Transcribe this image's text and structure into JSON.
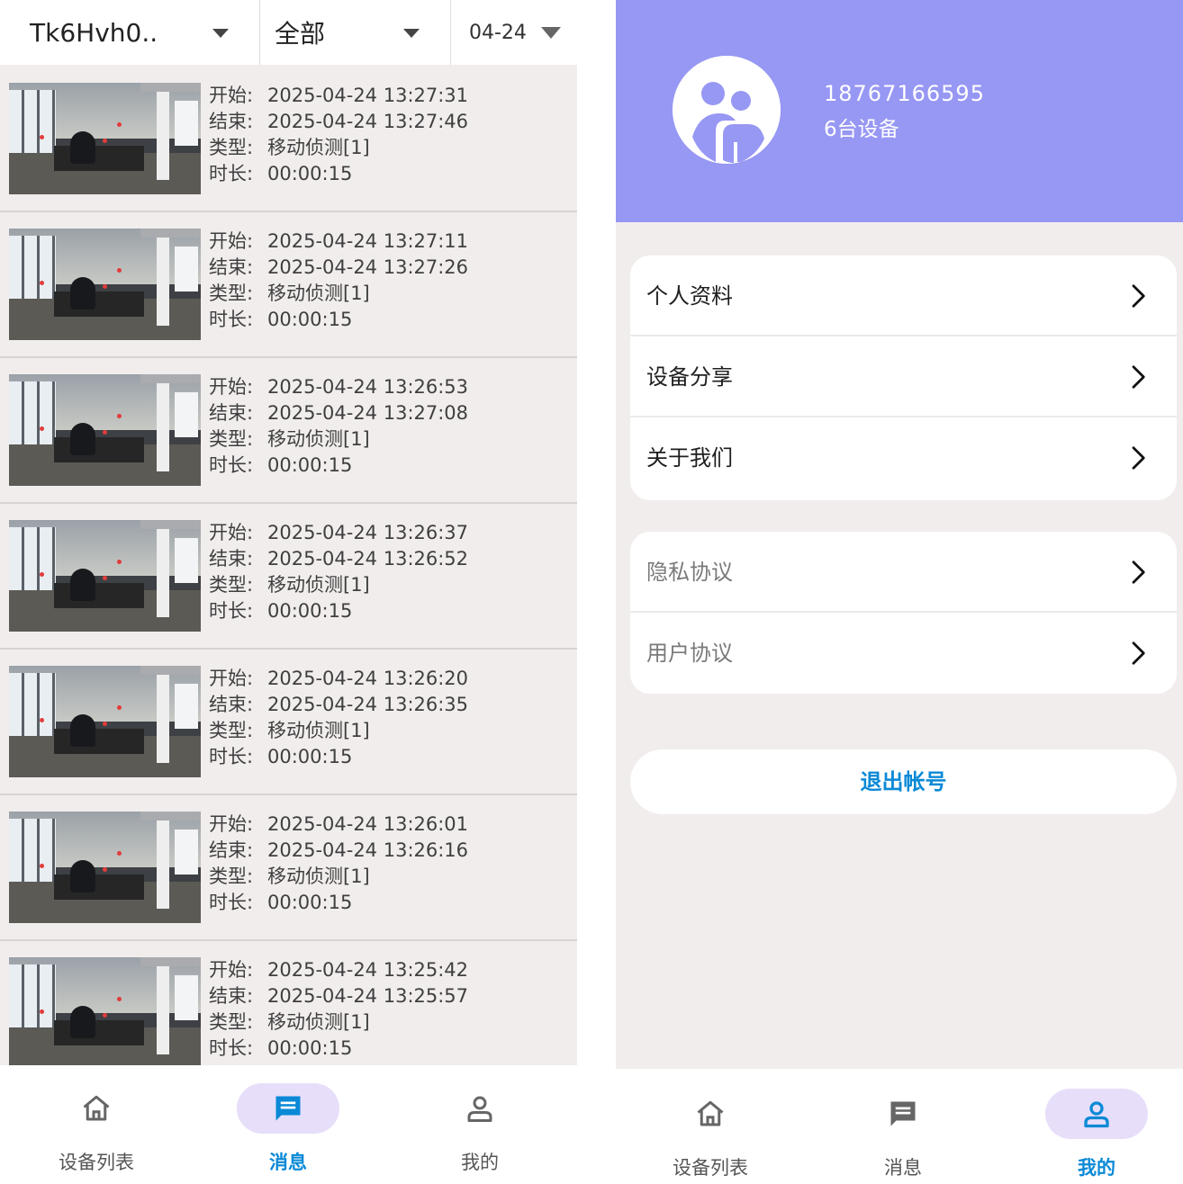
{
  "filters": {
    "device": "Tk6Hvh0..",
    "type": "全部",
    "date": "04-24"
  },
  "labels": {
    "start": "开始:",
    "end": "结束:",
    "type": "类型:",
    "duration": "时长:"
  },
  "records": [
    {
      "start": "2025-04-24 13:27:31",
      "end": "2025-04-24 13:27:46",
      "type": "移动侦测[1]",
      "duration": "00:00:15"
    },
    {
      "start": "2025-04-24 13:27:11",
      "end": "2025-04-24 13:27:26",
      "type": "移动侦测[1]",
      "duration": "00:00:15"
    },
    {
      "start": "2025-04-24 13:26:53",
      "end": "2025-04-24 13:27:08",
      "type": "移动侦测[1]",
      "duration": "00:00:15"
    },
    {
      "start": "2025-04-24 13:26:37",
      "end": "2025-04-24 13:26:52",
      "type": "移动侦测[1]",
      "duration": "00:00:15"
    },
    {
      "start": "2025-04-24 13:26:20",
      "end": "2025-04-24 13:26:35",
      "type": "移动侦测[1]",
      "duration": "00:00:15"
    },
    {
      "start": "2025-04-24 13:26:01",
      "end": "2025-04-24 13:26:16",
      "type": "移动侦测[1]",
      "duration": "00:00:15"
    },
    {
      "start": "2025-04-24 13:25:42",
      "end": "2025-04-24 13:25:57",
      "type": "移动侦测[1]",
      "duration": "00:00:15"
    }
  ],
  "nav": {
    "devices": "设备列表",
    "messages": "消息",
    "mine": "我的"
  },
  "profile": {
    "phone": "18767166595",
    "device_count": "6台设备"
  },
  "menu1": [
    {
      "label": "个人资料"
    },
    {
      "label": "设备分享"
    },
    {
      "label": "关于我们"
    }
  ],
  "menu2": [
    {
      "label": "隐私协议"
    },
    {
      "label": "用户协议"
    }
  ],
  "logout_label": "退出帐号",
  "colors": {
    "accent": "#0a89d6",
    "header": "#9797f4",
    "pill": "#e7defa",
    "background": "#f2eded"
  },
  "icons": {
    "home": "home-icon",
    "message": "message-icon",
    "person": "person-icon",
    "chevron": "chevron-right-icon",
    "avatar": "avatar-icon",
    "dropdown": "caret-down-icon"
  }
}
